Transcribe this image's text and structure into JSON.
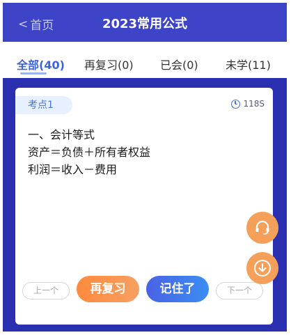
{
  "header": {
    "back_label": "首页",
    "back_chevron": "<",
    "title": "2023常用公式"
  },
  "tabs": [
    {
      "label": "全部(40)",
      "active": true
    },
    {
      "label": "再复习(0)",
      "active": false
    },
    {
      "label": "已会(0)",
      "active": false
    },
    {
      "label": "未学(11)",
      "active": false
    }
  ],
  "card": {
    "tag": "考点1",
    "timer": "118S",
    "lines": [
      "一、会计等式",
      "资产＝负债＋所有者权益",
      "利润＝收入－费用"
    ]
  },
  "buttons": {
    "prev": "上一个",
    "review": "再复习",
    "remember": "记住了",
    "next": "下一个"
  },
  "fabs": {
    "service_icon": "headset-icon",
    "download_icon": "download-icon"
  },
  "colors": {
    "header_bg": "#3d44c8",
    "content_bg": "#2a2fb0",
    "accent_blue": "#3b63e0",
    "accent_orange": "#f4a05a"
  }
}
